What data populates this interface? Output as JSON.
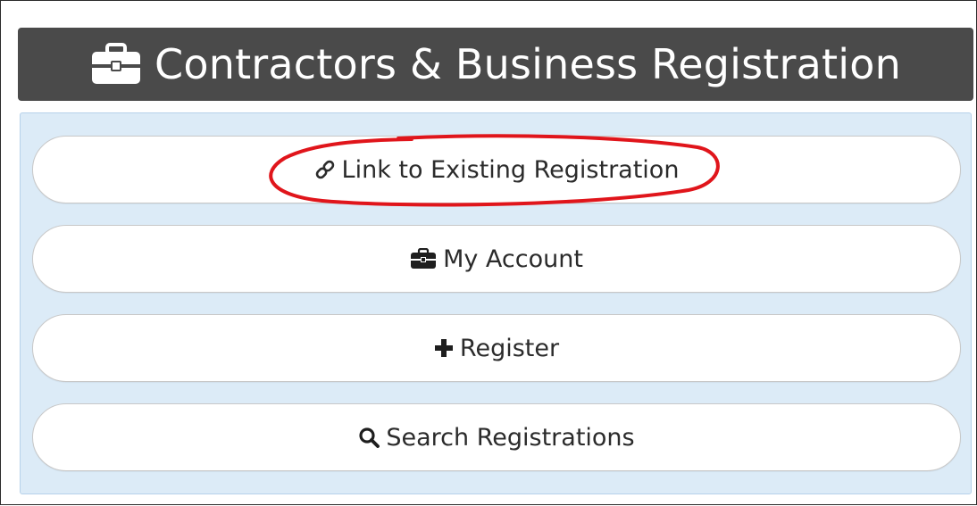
{
  "header": {
    "title": "Contractors & Business Registration",
    "icon": "briefcase-icon"
  },
  "menu": {
    "items": [
      {
        "label": "Link to Existing Registration",
        "icon": "link-icon"
      },
      {
        "label": "My Account",
        "icon": "briefcase-icon"
      },
      {
        "label": "Register",
        "icon": "plus-icon"
      },
      {
        "label": "Search Registrations",
        "icon": "search-icon"
      }
    ]
  },
  "colors": {
    "header_bg": "#4a4a4a",
    "panel_bg": "#dcebf7",
    "annotation": "#e0151b"
  }
}
